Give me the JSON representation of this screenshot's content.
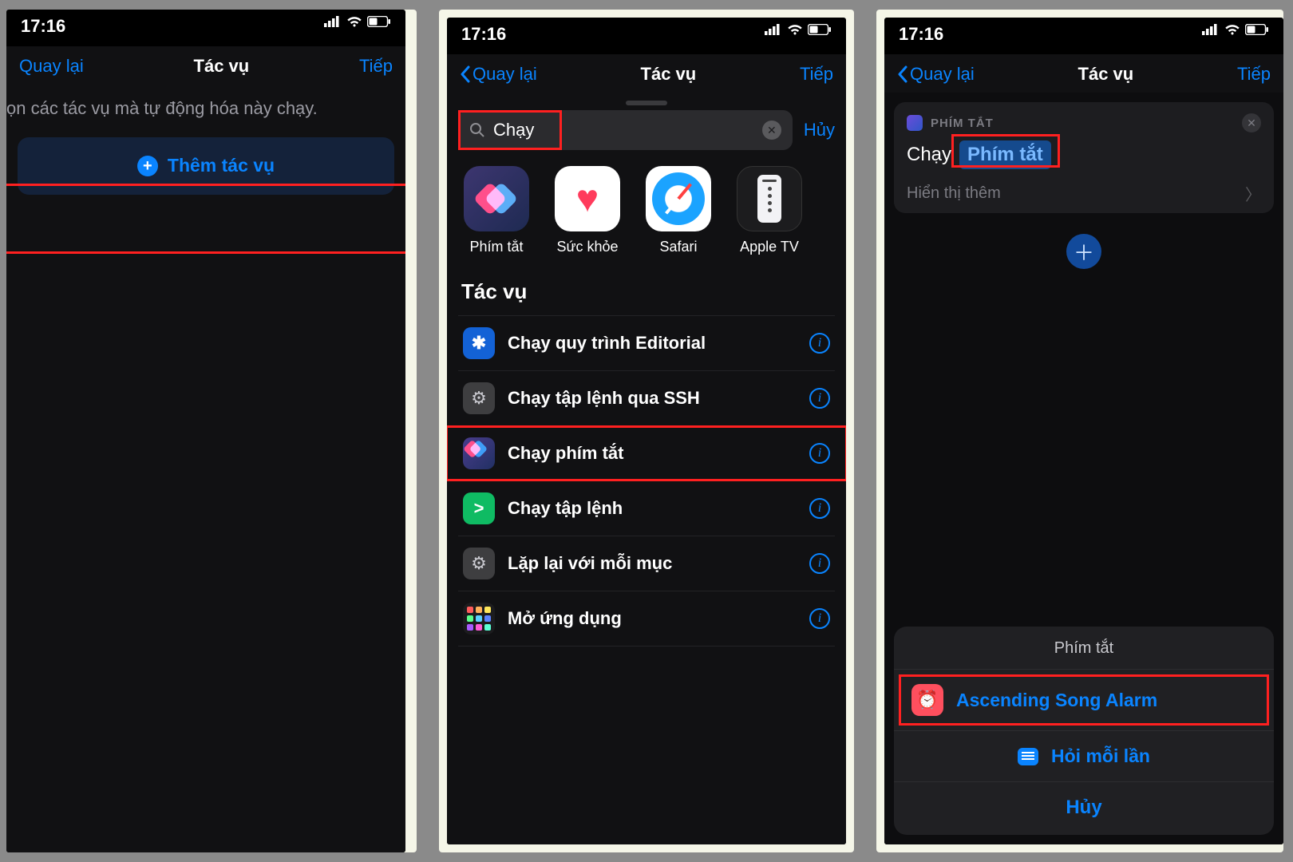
{
  "status": {
    "time": "17:16"
  },
  "nav": {
    "back": "Quay lại",
    "title": "Tác vụ",
    "next": "Tiếp"
  },
  "panel1": {
    "body_text_partial": "ọn các tác vụ mà tự động hóa này chạy.",
    "add_action": "Thêm tác vụ"
  },
  "panel2": {
    "search_value": "Chạy",
    "cancel": "Hủy",
    "apps": [
      {
        "label": "Phím tắt"
      },
      {
        "label": "Sức khỏe"
      },
      {
        "label": "Safari"
      },
      {
        "label": "Apple TV"
      }
    ],
    "section": "Tác vụ",
    "actions": [
      {
        "label": "Chạy quy trình Editorial"
      },
      {
        "label": "Chạy tập lệnh qua SSH"
      },
      {
        "label": "Chạy phím tắt"
      },
      {
        "label": "Chạy tập lệnh"
      },
      {
        "label": "Lặp lại với mỗi mục"
      },
      {
        "label": "Mở ứng dụng"
      }
    ]
  },
  "panel3": {
    "section_label": "PHÍM TẮT",
    "run_word": "Chạy",
    "token": "Phím tắt",
    "show_more": "Hiển thị thêm",
    "sheet_title": "Phím tắt",
    "shortcut_name": "Ascending Song Alarm",
    "ask_each": "Hỏi mỗi lần",
    "cancel": "Hủy"
  }
}
